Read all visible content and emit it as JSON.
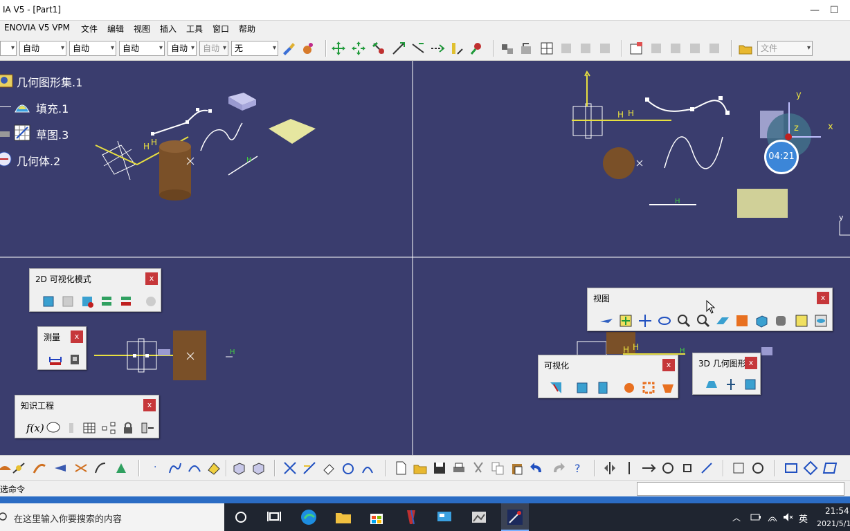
{
  "window": {
    "title": "IA V5 - [Part1]",
    "minimize": "—",
    "maximize": "☐"
  },
  "menu": [
    "ENOVIA V5 VPM",
    "文件",
    "编辑",
    "视图",
    "插入",
    "工具",
    "窗口",
    "帮助"
  ],
  "toolbar": {
    "combos": [
      "自动",
      "自动",
      "自动",
      "自动",
      "自动"
    ],
    "combo_disabled": "自动",
    "line_combo": "无",
    "file_combo": "文件"
  },
  "tree": {
    "items": [
      {
        "label": "几何图形集.1",
        "icon": "geometric-set-icon"
      },
      {
        "label": "填充.1",
        "icon": "fill-icon"
      },
      {
        "label": "草图.3",
        "icon": "sketch-icon"
      },
      {
        "label": "几何体.2",
        "icon": "body-icon"
      }
    ]
  },
  "compass": {
    "x": "x",
    "y": "y",
    "z": "z",
    "timer": "04:21"
  },
  "panels": {
    "vis2d": {
      "title": "2D 可视化模式",
      "close": "x"
    },
    "measure": {
      "title": "测量",
      "close": "x"
    },
    "knowledge": {
      "title": "知识工程",
      "close": "x"
    },
    "view": {
      "title": "视图",
      "close": "x"
    },
    "visual": {
      "title": "可视化",
      "close": "x"
    },
    "geo3d": {
      "title": "3D 几何图形",
      "close": "x"
    }
  },
  "status": {
    "text": "选命令",
    "progress": 1.0
  },
  "taskbar": {
    "search_placeholder": "在这里输入你要搜索的内容",
    "ime": "英",
    "time": "21:54",
    "date": "2021/5/1"
  },
  "colors": {
    "viewport": "#3a3d6e",
    "close_button": "#c6373a",
    "accent": "#2b6cc4"
  }
}
